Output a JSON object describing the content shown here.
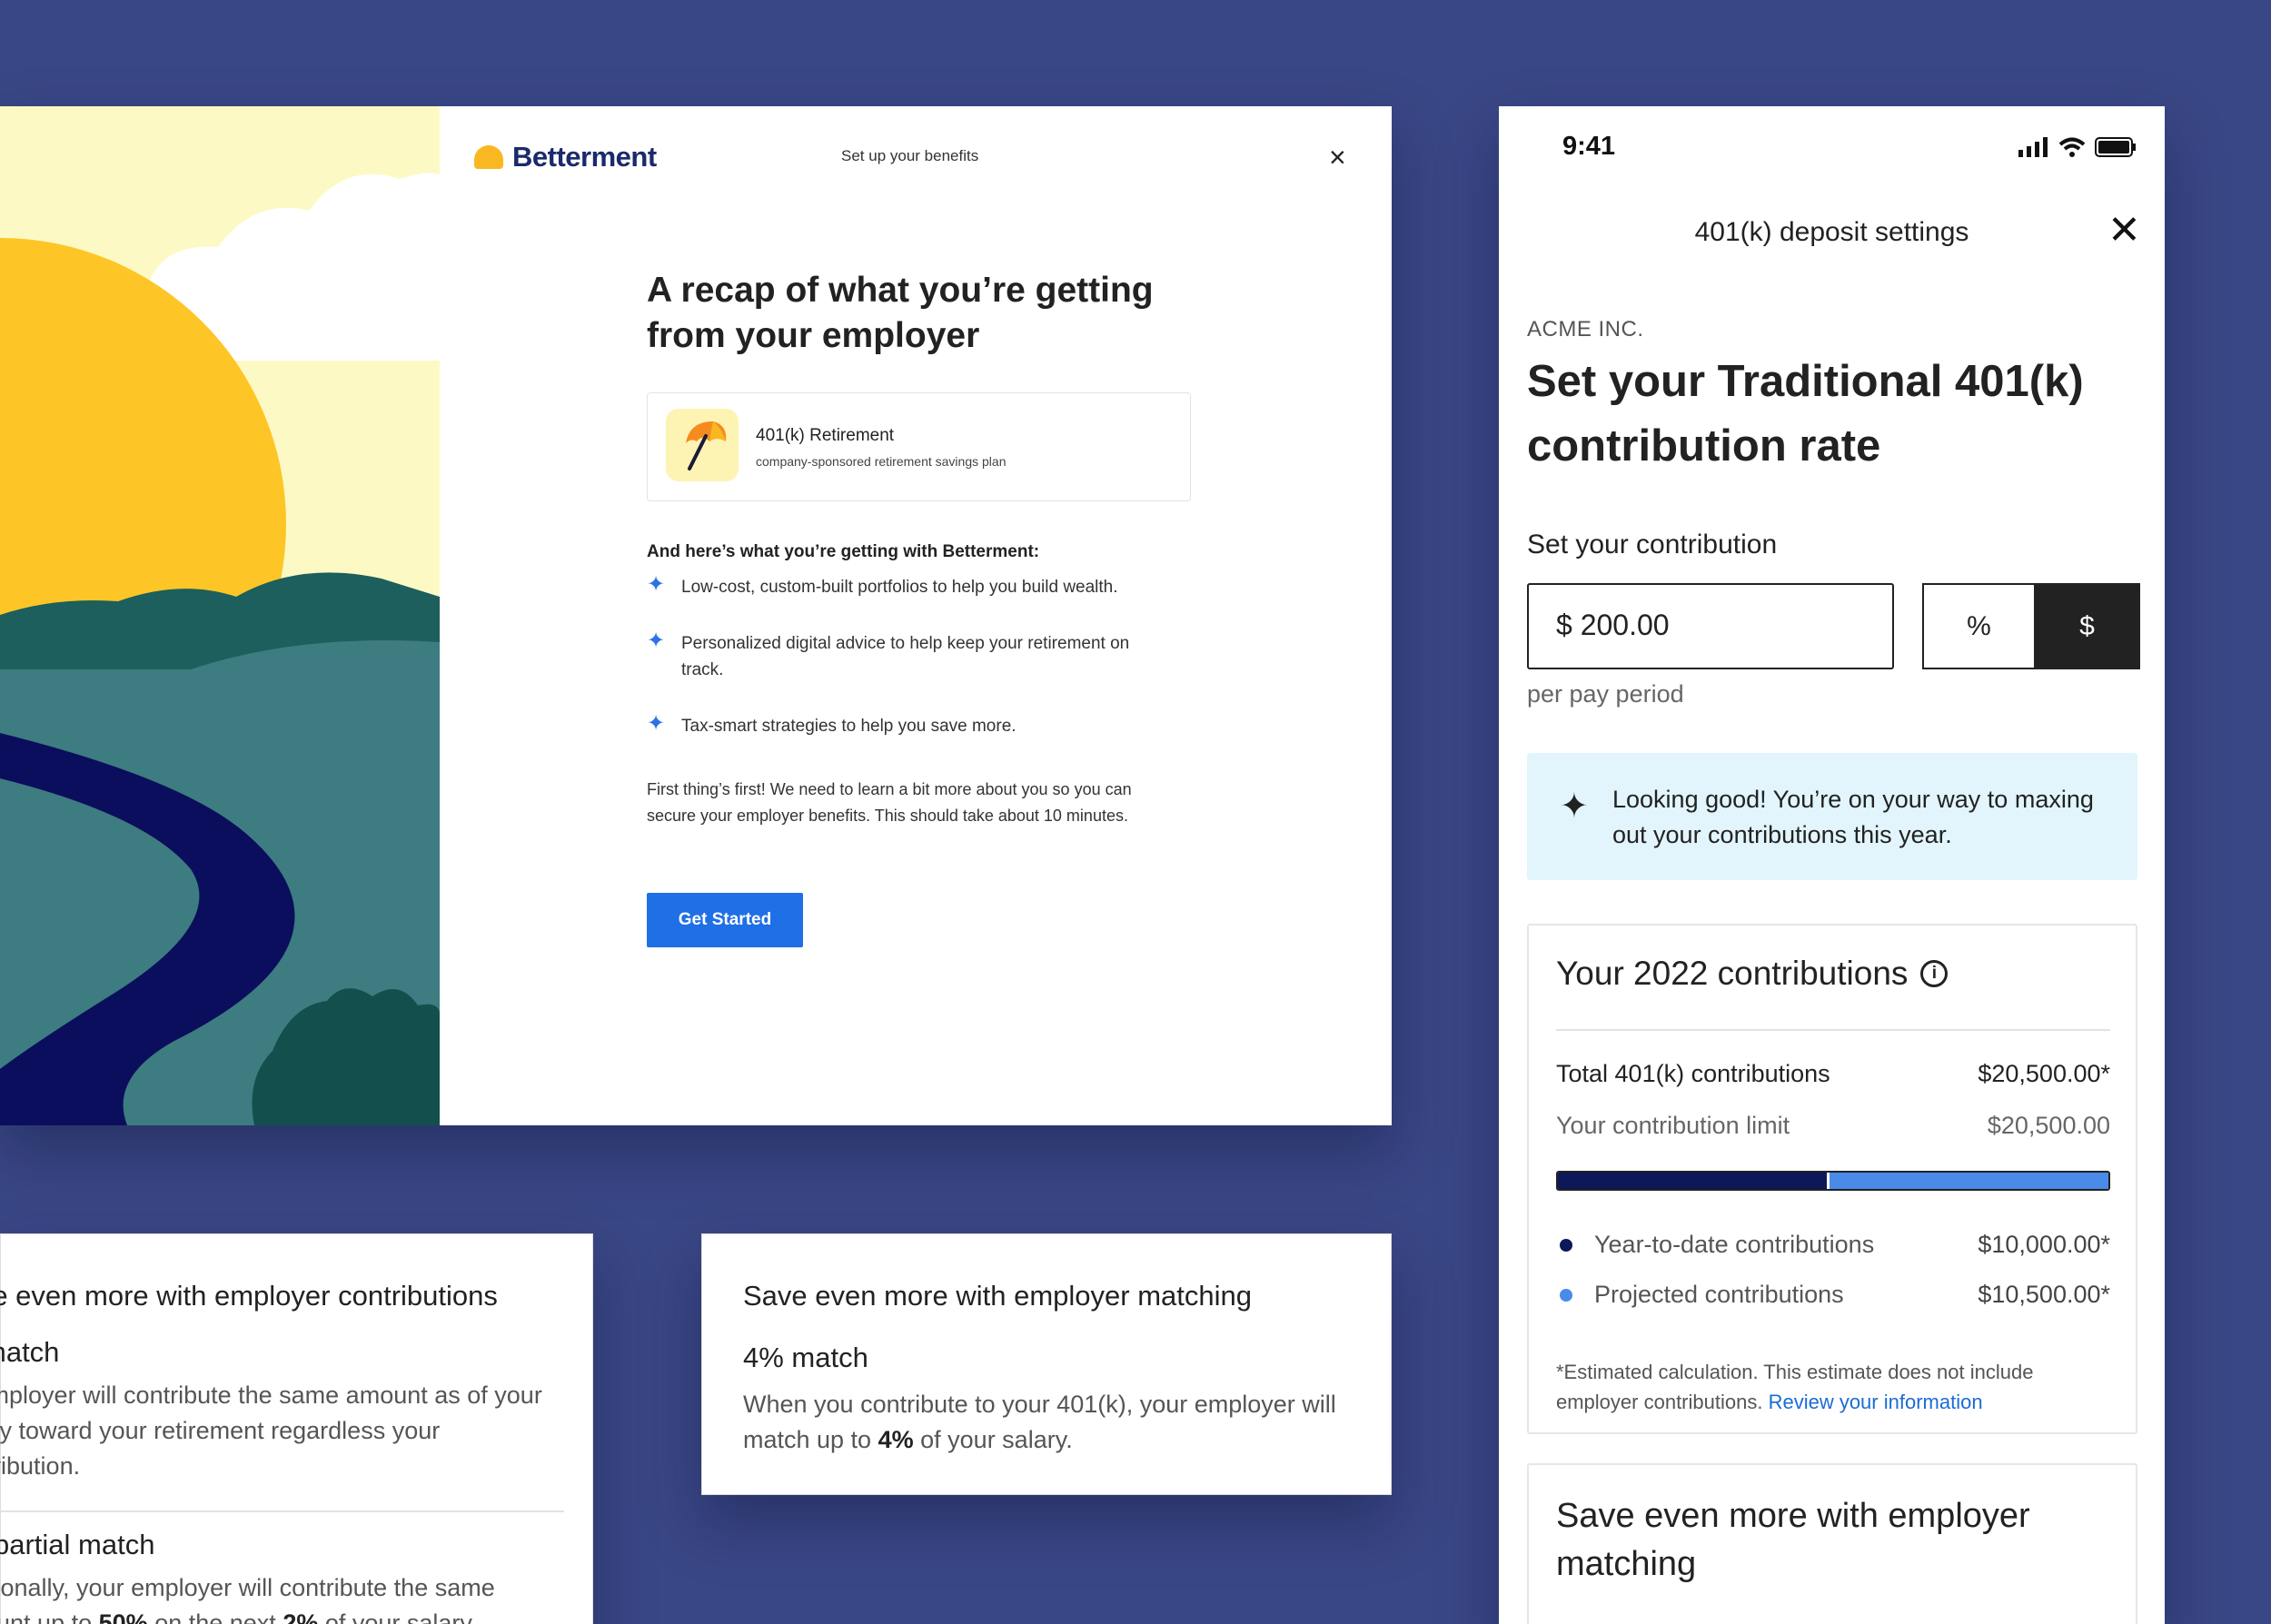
{
  "web": {
    "brand": "Betterment",
    "header_title": "Set up your benefits",
    "close_glyph": "×",
    "heading": "A recap of what you’re getting from your employer",
    "plan": {
      "name": "401(k) Retirement",
      "description": "company-sponsored retirement savings plan",
      "icon": "umbrella-icon"
    },
    "benefits_heading": "And here’s what you’re getting with Betterment:",
    "benefits": [
      "Low-cost, custom-built portfolios to help you build wealth.",
      "Personalized digital advice to help keep your retirement on track.",
      "Tax-smart strategies to help you save more."
    ],
    "intro": "First thing’s first! We need to learn a bit more about you so you can secure your employer benefits. This should take about 10 minutes.",
    "cta": "Get Started",
    "colors": {
      "brand_navy": "#1a2a6c",
      "brand_yellow": "#f9b821",
      "cta_blue": "#1f6fe6"
    }
  },
  "phone": {
    "time": "9:41",
    "title": "401(k) deposit settings",
    "close_glyph": "✕",
    "company": "ACME INC.",
    "heading": "Set your Traditional 401(k) contribution rate",
    "contribution_label": "Set your contribution",
    "amount": "$  200.00",
    "toggle_percent": "%",
    "toggle_dollar": "$",
    "selected_unit": "$",
    "per_pay_period": "per pay period",
    "tip": "Looking good! You’re on your way to maxing out your contributions this year.",
    "summary": {
      "title": "Your 2022 contributions",
      "info_glyph": "i",
      "total_label": "Total 401(k) contributions",
      "total_value": "$20,500.00*",
      "limit_label": "Your contribution limit",
      "limit_value": "$20,500.00",
      "progress": {
        "ytd_fraction": 0.4878,
        "projected_fraction": 0.5122
      },
      "legend": [
        {
          "label": "Year-to-date contributions",
          "value": "$10,000.00*",
          "color": "#0c1858"
        },
        {
          "label": "Projected contributions",
          "value": "$10,500.00*",
          "color": "#4a8ae8"
        }
      ],
      "footnote": "*Estimated calculation. This estimate does not include employer contributions.",
      "footnote_link": "Review your information"
    },
    "match_card_title": "Save even more with employer matching"
  },
  "match_card": {
    "title": "Save even more with employer matching",
    "match": "4% match",
    "desc_before": "When you contribute to your 401(k), your employer will match up to",
    "desc_bold": "4%",
    "desc_after": "of your salary."
  },
  "contrib_card": {
    "title": "re even more with employer contributions",
    "match": "match",
    "desc": "ur employer will contribute the same amount as of your salary toward your retirement regardless your contribution.",
    "partial": "partial match",
    "pdesc_1": "itionally, your employer will contribute the same",
    "pdesc_2a": "ount up to",
    "pdesc_b1": "50%",
    "pdesc_2b": "on the next",
    "pdesc_b2": "2%",
    "pdesc_2c": "of your salary"
  }
}
